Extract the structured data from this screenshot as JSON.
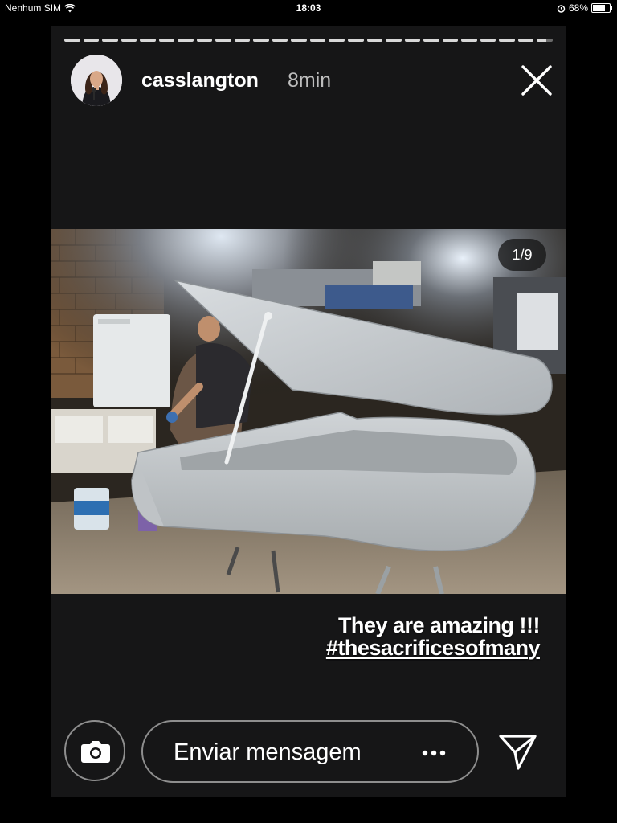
{
  "status_bar": {
    "carrier": "Nenhum SIM",
    "time": "18:03",
    "battery_percent": "68%",
    "battery_level": 0.68,
    "icons": [
      "wifi-icon",
      "alarm-icon",
      "battery-icon"
    ]
  },
  "story": {
    "progress_segments": 26,
    "active_segment_index": 25,
    "username": "casslangton",
    "time_ago": "8min",
    "close_icon": "close-icon",
    "photo_counter": "1/9",
    "caption_line1": "They are amazing !!!",
    "caption_hashtag": "#thesacrificesofmany"
  },
  "bottom_bar": {
    "camera_icon": "camera-icon",
    "message_placeholder": "Enviar mensagem",
    "more_icon": "more-dots-icon",
    "send_icon": "send-icon"
  },
  "colors": {
    "background": "#000000",
    "story_background": "#161617",
    "text": "#ffffff",
    "muted_text": "#bdbdbd",
    "outline": "#8e8e8e"
  }
}
